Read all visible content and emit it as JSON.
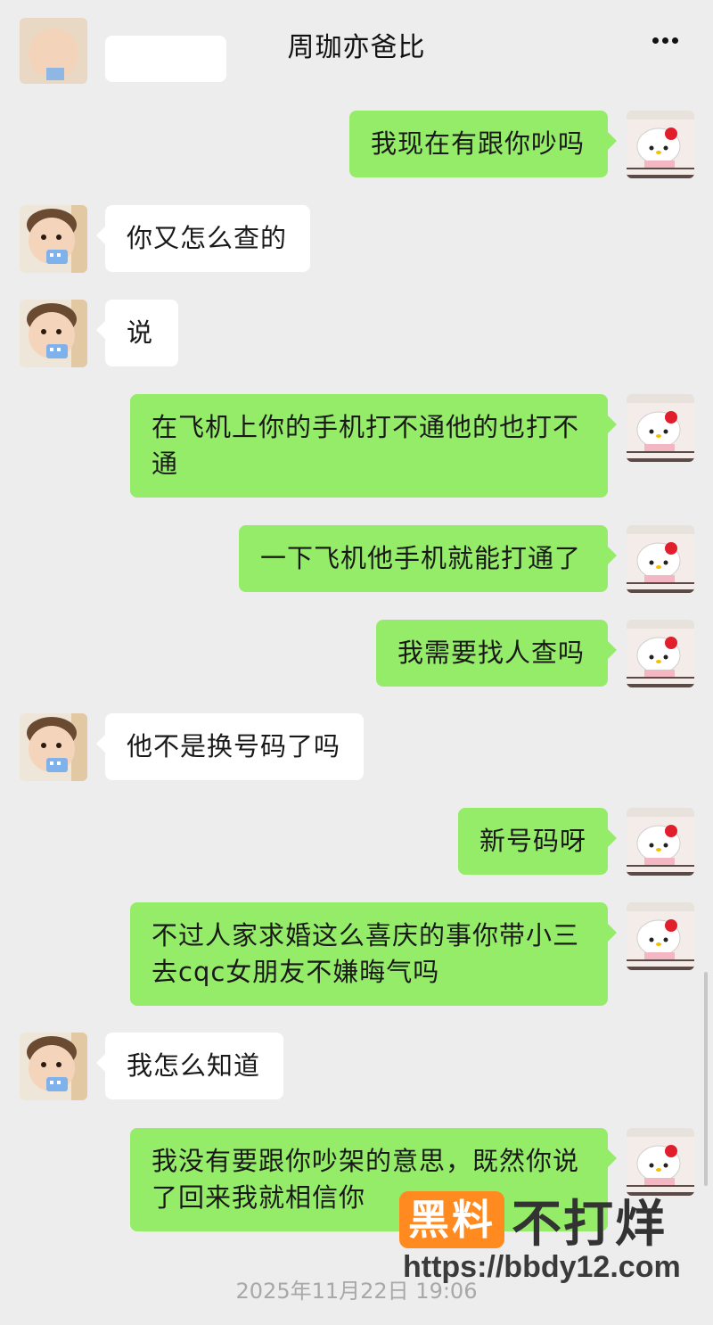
{
  "header": {
    "title": "周珈亦爸比"
  },
  "messages": [
    {
      "side": "out",
      "text": "我现在有跟你吵吗"
    },
    {
      "side": "in",
      "text": "你又怎么查的"
    },
    {
      "side": "in",
      "text": "说"
    },
    {
      "side": "out",
      "text": "在飞机上你的手机打不通他的也打不通"
    },
    {
      "side": "out",
      "text": "一下飞机他手机就能打通了"
    },
    {
      "side": "out",
      "text": "我需要找人查吗"
    },
    {
      "side": "in",
      "text": "他不是换号码了吗"
    },
    {
      "side": "out",
      "text": "新号码呀"
    },
    {
      "side": "out",
      "text": "不过人家求婚这么喜庆的事你带小三去cqc女朋友不嫌晦气吗"
    },
    {
      "side": "in",
      "text": "我怎么知道"
    },
    {
      "side": "out",
      "text": "我没有要跟你吵架的意思，既然你说了回来我就相信你"
    }
  ],
  "timestamp": "2025年11月22日 19:06",
  "watermark": {
    "logo_box": "黑料",
    "logo_text": "不打烊",
    "url": "https://bbdy12.com"
  },
  "colors": {
    "background": "#ededed",
    "outgoing_bubble": "#95ec69",
    "incoming_bubble": "#ffffff",
    "watermark_accent": "#ff8a1f"
  }
}
